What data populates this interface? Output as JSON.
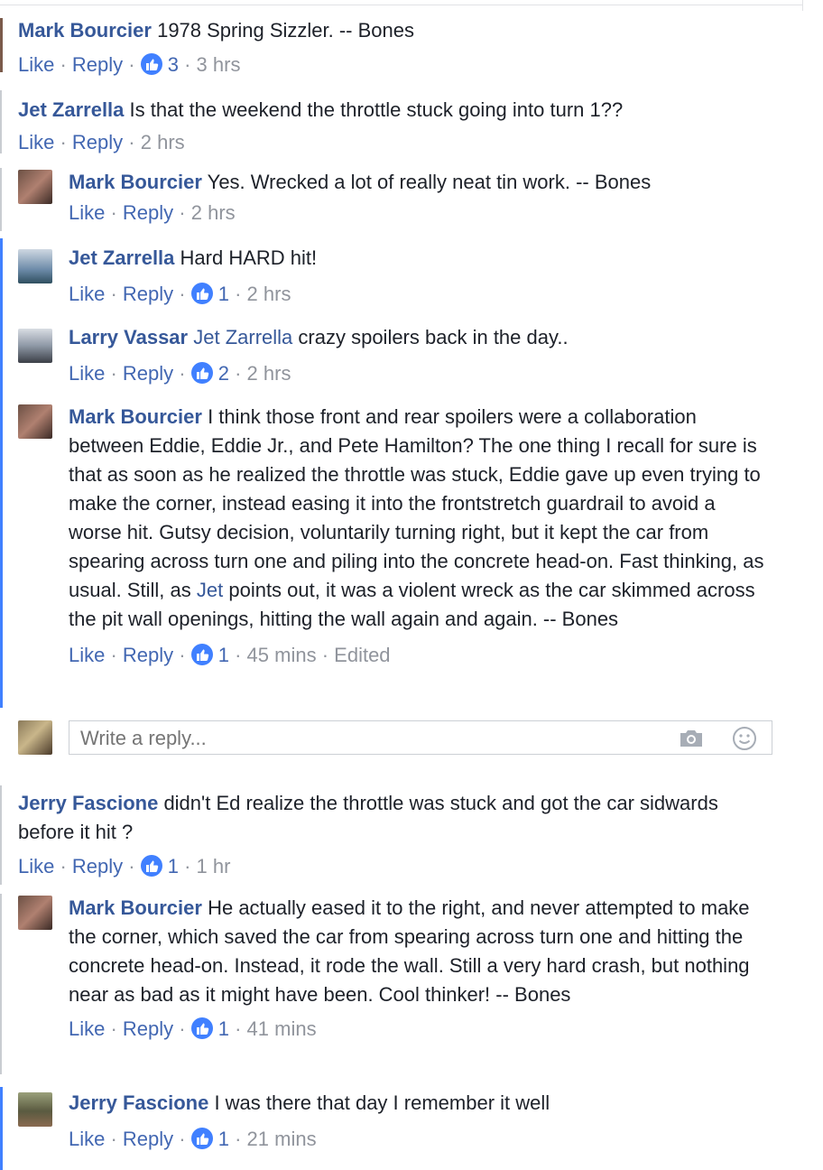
{
  "comments": [
    {
      "name": "Mark Bourcier",
      "text": "1978 Spring Sizzler. -- Bones",
      "like": "Like",
      "reply": "Reply",
      "count": "3",
      "time": "3 hrs"
    },
    {
      "name": "Jet Zarrella",
      "text": "Is that the weekend the throttle stuck going into turn 1??",
      "like": "Like",
      "reply": "Reply",
      "time": "2 hrs"
    },
    {
      "name": "Mark Bourcier",
      "text": "Yes. Wrecked a lot of really neat tin work. -- Bones",
      "like": "Like",
      "reply": "Reply",
      "time": "2 hrs"
    },
    {
      "name": "Jet Zarrella",
      "text": "Hard HARD hit!",
      "like": "Like",
      "reply": "Reply",
      "count": "1",
      "time": "2 hrs"
    },
    {
      "name": "Larry Vassar",
      "mention": "Jet Zarrella",
      "text": "crazy spoilers back in the day..",
      "like": "Like",
      "reply": "Reply",
      "count": "2",
      "time": "2 hrs"
    },
    {
      "name": "Mark Bourcier",
      "text_a": "I think those front and rear spoilers were a collaboration between Eddie, Eddie Jr., and Pete Hamilton? The one thing I recall for sure is that as soon as he realized the throttle was stuck, Eddie gave up even trying to make the corner, instead easing it into the frontstretch guardrail to avoid a worse hit. Gutsy decision, voluntarily turning right, but it kept the car from spearing across turn one and piling into the concrete head-on. Fast thinking, as usual. Still, as",
      "mention": "Jet",
      "text_b": "points out, it was a violent wreck as the car skimmed across the pit wall openings, hitting the wall again and again. -- Bones",
      "like": "Like",
      "reply": "Reply",
      "count": "1",
      "time": "45 mins",
      "edited": "Edited"
    },
    {
      "name": "Jerry Fascione",
      "text": "didn't Ed realize the throttle was stuck and got the car sidwards before it hit ?",
      "like": "Like",
      "reply": "Reply",
      "count": "1",
      "time": "1 hr"
    },
    {
      "name": "Mark Bourcier",
      "text": "He actually eased it to the right, and never attempted to make the corner, which saved the car from spearing across turn one and hitting the concrete head-on. Instead, it rode the wall. Still a very hard crash, but nothing near as bad as it might have been. Cool thinker! -- Bones",
      "like": "Like",
      "reply": "Reply",
      "count": "1",
      "time": "41 mins"
    },
    {
      "name": "Jerry Fascione",
      "text": "I was there that day I remember it well",
      "like": "Like",
      "reply": "Reply",
      "count": "1",
      "time": "21 mins"
    }
  ],
  "reply_box": {
    "placeholder": "Write a reply..."
  },
  "icons": {
    "like": "thumbs-up-icon",
    "camera": "camera-icon",
    "emoji": "smiley-icon"
  },
  "colors": {
    "name": "#365899",
    "accent": "#4080ff",
    "meta": "#90949c"
  }
}
